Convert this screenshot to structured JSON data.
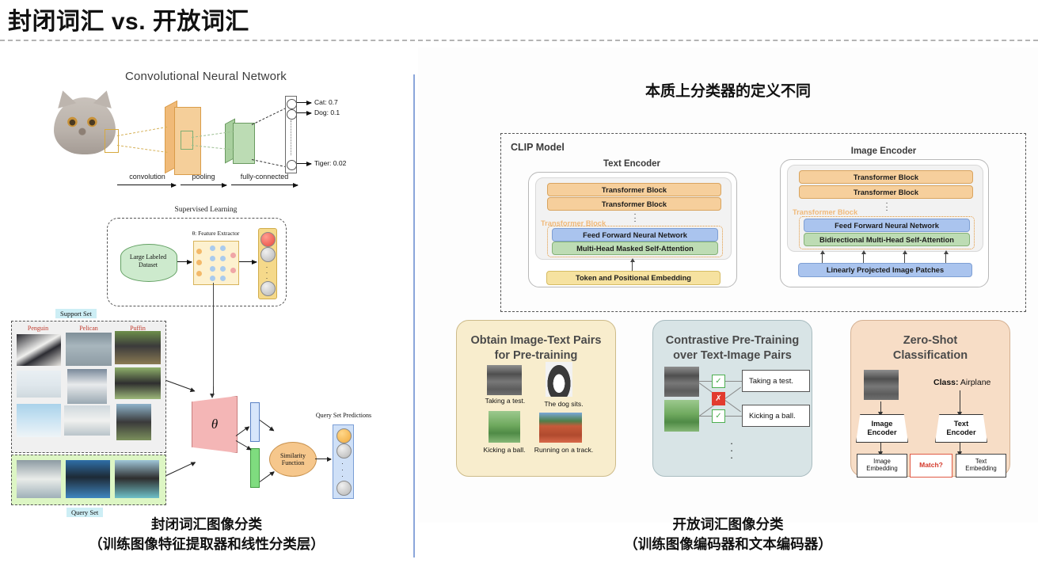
{
  "header": {
    "title": "封闭词汇 vs. 开放词汇"
  },
  "left_panel": {
    "cnn": {
      "title": "Convolutional Neural Network",
      "stages": [
        "convolution",
        "pooling",
        "fully-connected"
      ],
      "outputs": [
        "Cat: 0.7",
        "Dog: 0.1",
        "Tiger: 0.02"
      ]
    },
    "few_shot": {
      "supervised_title": "Supervised Learning",
      "dataset_label": "Large Labeled Dataset",
      "feature_extractor_label": "θ: Feature Extractor",
      "support_set_label": "Support Set",
      "query_set_label": "Query Set",
      "support_columns": [
        "Penguin",
        "Pelican",
        "Puffin"
      ],
      "theta_symbol": "θ",
      "similarity_label": "Similarity Function",
      "predictions_label": "Query Set Predictions",
      "dots": "·"
    },
    "caption_line1": "封闭词汇图像分类",
    "caption_line2": "（训练图像特征提取器和线性分类层）"
  },
  "right_panel": {
    "title": "本质上分类器的定义不同",
    "clip": {
      "model_label": "CLIP Model",
      "text_encoder": {
        "title": "Text Encoder",
        "blocks": [
          "Transformer Block",
          "Transformer Block"
        ],
        "ghost_block": "Transformer Block",
        "ffn": "Feed Forward Neural Network",
        "attention": "Multi-Head Masked Self-Attention",
        "input": "Token and Positional Embedding"
      },
      "image_encoder": {
        "title": "Image Encoder",
        "blocks": [
          "Transformer Block",
          "Transformer Block"
        ],
        "ghost_block": "Transformer Block",
        "ffn": "Feed Forward Neural Network",
        "attention": "Bidirectional Multi-Head Self-Attention",
        "input": "Linearly Projected Image Patches"
      }
    },
    "panels": [
      {
        "title": "Obtain Image-Text Pairs\nfor Pre-training",
        "captions": [
          "Taking a test.",
          "The dog sits.",
          "Kicking a ball.",
          "Running on a track."
        ]
      },
      {
        "title": "Contrastive Pre-Training\nover Text-Image Pairs",
        "texts": [
          "Taking a test.",
          "Kicking a ball."
        ],
        "marks": [
          "✓",
          "✗",
          "✓"
        ]
      },
      {
        "title": "Zero-Shot\nClassification",
        "class_prefix": "Class:",
        "class_value": "Airplane",
        "image_encoder": "Image\nEncoder",
        "text_encoder": "Text\nEncoder",
        "image_embedding": "Image\nEmbedding",
        "text_embedding": "Text\nEmbedding",
        "match": "Match?"
      }
    ],
    "caption_line1": "开放词汇图像分类",
    "caption_line2": "（训练图像编码器和文本编码器）"
  },
  "colors": {
    "divider_blue": "#8ba6da",
    "transformer_block": "#f6cf9c",
    "ffn_blue": "#aac4ee",
    "attention_green": "#bddcb4",
    "token_yellow": "#f6e2a0",
    "panel1_bg": "#f8edcd",
    "panel2_bg": "#d8e4e6",
    "panel3_bg": "#f7ddc6",
    "match_red": "#d4382a",
    "ok_green": "#4caf50"
  }
}
